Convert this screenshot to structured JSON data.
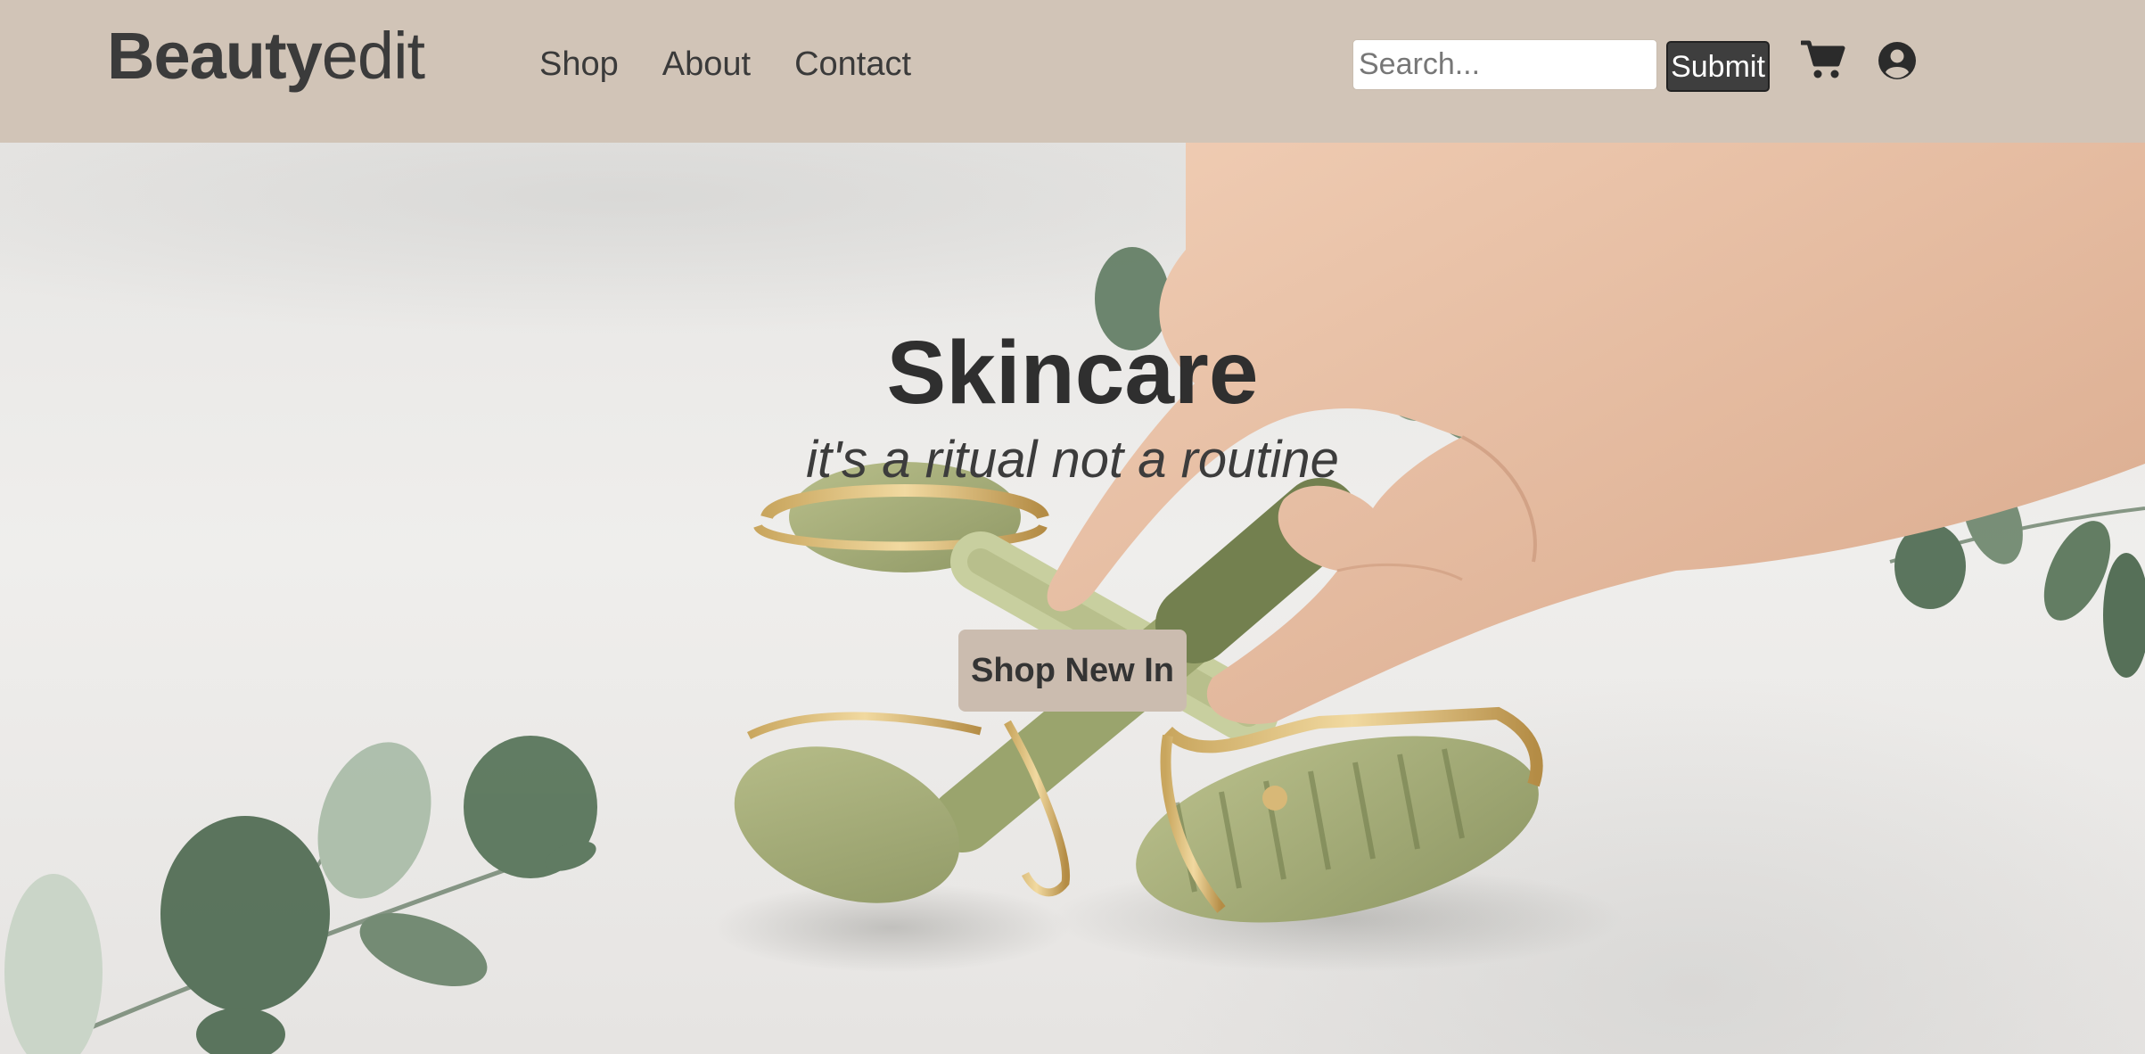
{
  "brand": {
    "name_bold": "Beauty",
    "name_light": "edit"
  },
  "nav": {
    "items": [
      {
        "label": "Shop"
      },
      {
        "label": "About"
      },
      {
        "label": "Contact"
      }
    ]
  },
  "search": {
    "placeholder": "Search...",
    "value": "",
    "submit_label": "Submit"
  },
  "icons": {
    "cart": "shopping-cart-icon",
    "account": "user-circle-icon"
  },
  "hero": {
    "title": "Skincare",
    "subtitle": "it's a ritual not a routine",
    "cta_label": "Shop New In"
  },
  "colors": {
    "header_bg": "#d1c4b7",
    "text_dark": "#2f2f2f",
    "cta_bg": "#cbbcaf",
    "submit_bg": "#3e3e3e"
  }
}
